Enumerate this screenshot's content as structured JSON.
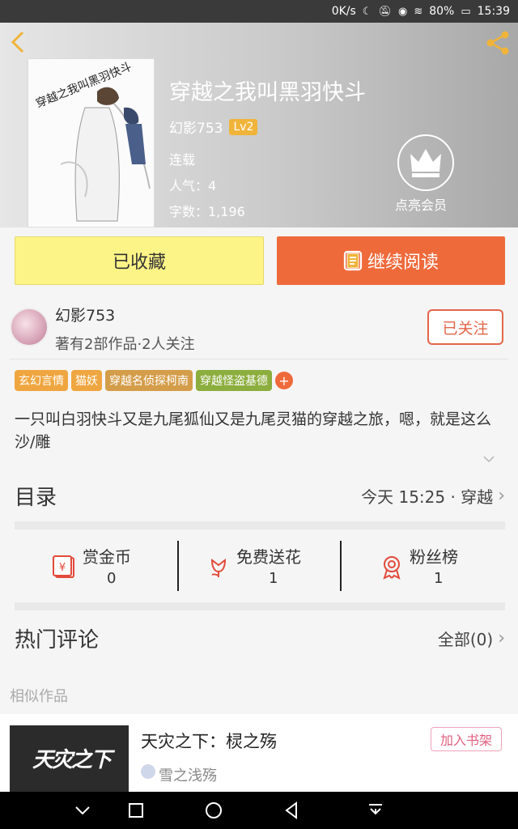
{
  "status_bar": {
    "speed": "0K/s",
    "battery": "80%",
    "time": "15:39",
    "icons": [
      "moon-icon",
      "mute-icon",
      "eye-icon",
      "wifi-icon",
      "battery-icon"
    ]
  },
  "book": {
    "cover_text": "穿越之我叫黑羽快斗",
    "title": "穿越之我叫黑羽快斗",
    "author": "幻影753",
    "level": "Lv2",
    "status": "连载",
    "popularity": "人气：4",
    "word_count": "字数：1,196",
    "vip_label": "点亮会员"
  },
  "actions": {
    "favorited": "已收藏",
    "continue_reading": "继续阅读"
  },
  "author_card": {
    "name": "幻影753",
    "stats": "著有2部作品·2人关注",
    "follow_label": "已关注"
  },
  "tags": [
    {
      "label": "玄幻言情",
      "color": "#f0a640"
    },
    {
      "label": "猫妖",
      "color": "#f0a640"
    },
    {
      "label": "穿越名侦探柯南",
      "color": "#d49d4a"
    },
    {
      "label": "穿越怪盗基德",
      "color": "#8cae3e"
    }
  ],
  "description": "一只叫白羽快斗又是九尾狐仙又是九尾灵猫的穿越之旅，嗯，就是这么沙/雕",
  "catalog": {
    "title": "目录",
    "latest": "今天 15:25 · 穿越"
  },
  "stats": [
    {
      "label": "赏金币",
      "value": "0"
    },
    {
      "label": "免费送花",
      "value": "1"
    },
    {
      "label": "粉丝榜",
      "value": "1"
    }
  ],
  "comments": {
    "title": "热门评论",
    "all_label": "全部(0)"
  },
  "similar": {
    "label": "相似作品",
    "items": [
      {
        "title": "天灾之下：棂之殇",
        "author": "雪之浅殇",
        "add_label": "加入书架",
        "thumb_text": "天灾之下"
      }
    ]
  },
  "colors": {
    "accent_orange": "#ef6a3b",
    "fav_yellow": "#fdf487",
    "follow_red": "#e3664a",
    "badge_gold": "#f0b43a"
  }
}
